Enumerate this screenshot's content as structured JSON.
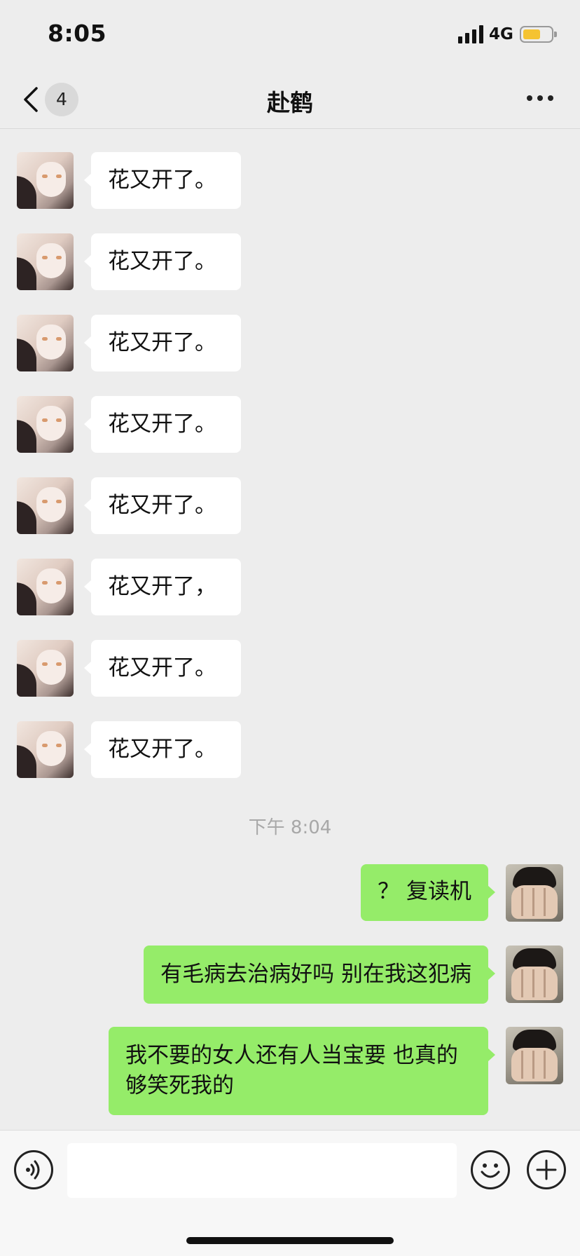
{
  "status_bar": {
    "time": "8:05",
    "network": "4G",
    "battery_level": 0.6,
    "battery_color": "#f5c331"
  },
  "nav": {
    "back_icon": "chevron-left-icon",
    "unread_count": "4",
    "title": "赴鹤",
    "more_icon": "more-dots-icon"
  },
  "chat": {
    "incoming": [
      {
        "text": "花又开了。"
      },
      {
        "text": "花又开了。"
      },
      {
        "text": "花又开了。"
      },
      {
        "text": "花又开了。"
      },
      {
        "text": "花又开了。"
      },
      {
        "text": "花又开了，"
      },
      {
        "text": "花又开了。"
      },
      {
        "text": "花又开了。"
      }
    ],
    "timestamp": "下午 8:04",
    "outgoing": [
      {
        "text": "？ 复读机"
      },
      {
        "text": "有毛病去治病好吗 别在我这犯病"
      },
      {
        "text": "我不要的女人还有人当宝要 也真的够笑死我的"
      }
    ],
    "bubble_colors": {
      "incoming": "#ffffff",
      "outgoing": "#95ec69"
    }
  },
  "input_bar": {
    "voice_icon": "voice-icon",
    "text_value": "",
    "emoji_icon": "emoji-icon",
    "plus_icon": "plus-icon"
  }
}
